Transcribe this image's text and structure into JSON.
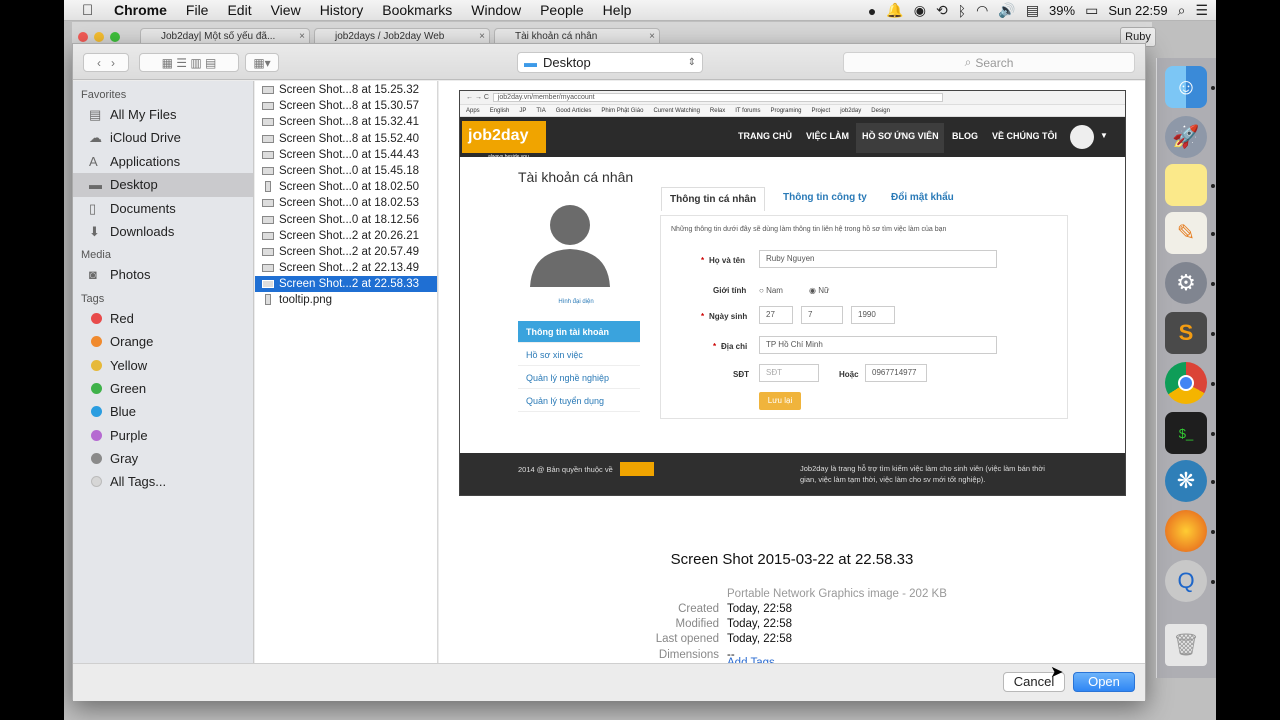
{
  "menubar": {
    "apple": "",
    "app_name": "Chrome",
    "items": [
      "File",
      "Edit",
      "View",
      "History",
      "Bookmarks",
      "Window",
      "People",
      "Help"
    ],
    "battery": "39%",
    "clock": "Sun 22:59"
  },
  "browser": {
    "tabs": [
      "Job2day| Một số yếu đã...",
      "job2days / Job2day Web",
      "Tài khoản cá nhân"
    ],
    "profile": "Ruby"
  },
  "toolbar": {
    "location": "Desktop",
    "search_placeholder": "Search"
  },
  "sidebar": {
    "favorites_header": "Favorites",
    "favorites": [
      {
        "label": "All My Files",
        "icon": "files-icon"
      },
      {
        "label": "iCloud Drive",
        "icon": "cloud-icon"
      },
      {
        "label": "Applications",
        "icon": "applications-icon"
      },
      {
        "label": "Desktop",
        "icon": "desktop-icon"
      },
      {
        "label": "Documents",
        "icon": "documents-icon"
      },
      {
        "label": "Downloads",
        "icon": "downloads-icon"
      }
    ],
    "media_header": "Media",
    "media": [
      {
        "label": "Photos",
        "icon": "camera-icon"
      }
    ],
    "tags_header": "Tags",
    "tags": [
      {
        "label": "Red",
        "color": "#e84b4b"
      },
      {
        "label": "Orange",
        "color": "#f08a2e"
      },
      {
        "label": "Yellow",
        "color": "#e6b93a"
      },
      {
        "label": "Green",
        "color": "#3fb24a"
      },
      {
        "label": "Blue",
        "color": "#2a9de0"
      },
      {
        "label": "Purple",
        "color": "#b56ad1"
      },
      {
        "label": "Gray",
        "color": "#8a8a8a"
      },
      {
        "label": "All Tags...",
        "color": "#d6d6d6"
      }
    ]
  },
  "files": [
    "Screen Shot...8 at 15.25.32",
    "Screen Shot...8 at 15.30.57",
    "Screen Shot...8 at 15.32.41",
    "Screen Shot...8 at 15.52.40",
    "Screen Shot...0 at 15.44.43",
    "Screen Shot...0 at 15.45.18",
    "Screen Shot...0 at 18.02.50",
    "Screen Shot...0 at 18.02.53",
    "Screen Shot...0 at 18.12.56",
    "Screen Shot...2 at 20.26.21",
    "Screen Shot...2 at 20.57.49",
    "Screen Shot...2 at 22.13.49",
    "Screen Shot...2 at 22.58.33",
    "tooltip.png"
  ],
  "selected_file_index": 12,
  "thumbnail": {
    "url": "job2day.vn/member/myaccount",
    "bookmarks": [
      "Apps",
      "English",
      "JP",
      "TIA",
      "Good Articles",
      "Phim Phật Giáo",
      "Current Watching",
      "Relax",
      "IT forums",
      "Programing",
      "Project",
      "job2day",
      "Design"
    ],
    "logo": "job2day",
    "logo_tagline": "always beside you",
    "nav": [
      "TRANG CHỦ",
      "VIỆC LÀM",
      "HỒ SƠ ỨNG VIÊN",
      "BLOG",
      "VỀ CHÚNG TÔI"
    ],
    "page_title": "Tài khoản cá nhân",
    "avatar_caption": "Hình đại diện",
    "left_menu": [
      "Thông tin tài khoản",
      "Hồ sơ xin việc",
      "Quản lý nghề nghiệp",
      "Quản lý tuyển dụng"
    ],
    "form_tabs": [
      "Thông tin cá nhân",
      "Thông tin công ty",
      "Đổi mật khẩu"
    ],
    "form_intro": "Những thông tin dưới đây sẽ dùng làm thông tin liên hệ trong hồ sơ tìm việc làm của bạn",
    "label_name": "Họ và tên",
    "name_value": "Ruby Nguyen",
    "label_gender": "Giới tính",
    "gender_male": "Nam",
    "gender_female": "Nữ",
    "label_dob": "Ngày sinh",
    "dob_day": "27",
    "dob_month": "7",
    "dob_year": "1990",
    "label_address": "Địa chỉ",
    "address_value": "TP Hồ Chí Minh",
    "label_phone": "SĐT",
    "phone_value": "SĐT",
    "label_or": "Hoặc",
    "phone2_value": "0967714977",
    "save_label": "Lưu lại",
    "footer_left": "2014 @ Bản quyền thuộc về",
    "footer_right": "Job2day là trang hỗ trợ tìm kiếm việc làm cho sinh viên (việc làm bán thời gian, việc làm tạm thời, việc làm cho sv mới tốt nghiệp)."
  },
  "preview": {
    "title": "Screen Shot 2015-03-22 at 22.58.33",
    "kind": "Portable Network Graphics image - 202 KB",
    "created_label": "Created",
    "created": "Today, 22:58",
    "modified_label": "Modified",
    "modified": "Today, 22:58",
    "opened_label": "Last opened",
    "opened": "Today, 22:58",
    "dimensions_label": "Dimensions",
    "dimensions": "--",
    "add_tags": "Add Tags..."
  },
  "buttons": {
    "cancel": "Cancel",
    "open": "Open"
  }
}
